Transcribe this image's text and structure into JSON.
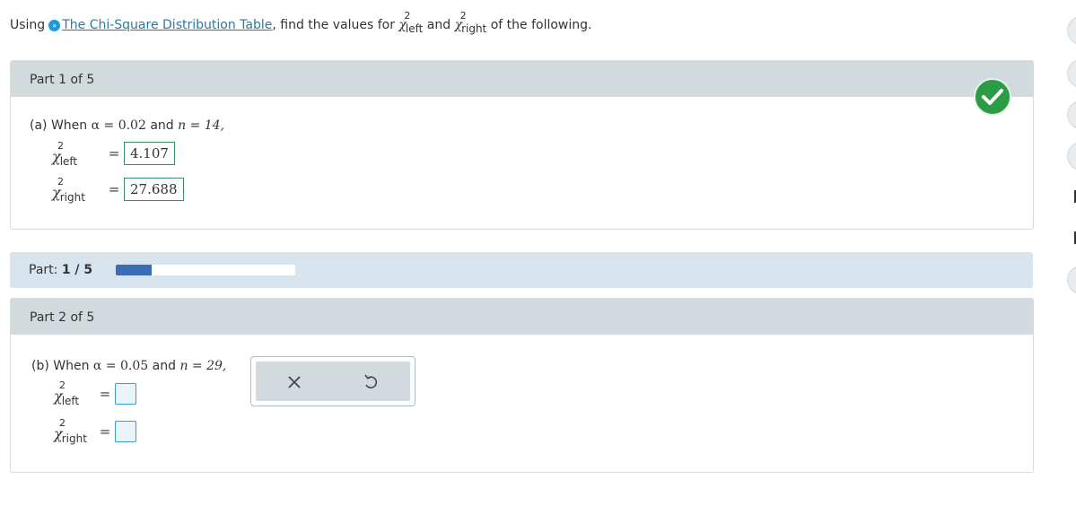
{
  "intro": {
    "prefix": "Using",
    "link_text": "The Chi-Square Distribution Table",
    "middle": ", find the values for",
    "and": "and",
    "suffix": "of the following."
  },
  "chi": {
    "symbol": "χ",
    "sup": "2",
    "left_sub": "left",
    "right_sub": "right"
  },
  "part1": {
    "header": "Part 1 of 5",
    "label": "(a) When",
    "alpha_expr": "α = 0.02",
    "and": "and",
    "n_expr": "n = 14,",
    "eq": "=",
    "left_value": "4.107",
    "right_value": "27.688",
    "status": "correct"
  },
  "progress": {
    "label": "Part:",
    "value": "1 / 5",
    "fraction": 0.2,
    "color": "#3a6db3"
  },
  "part2": {
    "header": "Part 2 of 5",
    "label": "(b) When",
    "alpha_expr": "α = 0.05",
    "and": "and",
    "n_expr": "n = 29,",
    "eq": "=",
    "left_value": "",
    "right_value": ""
  },
  "tools": {
    "clear_icon": "x-icon",
    "undo_icon": "undo-icon"
  },
  "colors": {
    "header_bg": "#d3dade",
    "progress_bg": "#d8e5ef",
    "check_green": "#2b9b45",
    "link": "#2a7aa3"
  }
}
